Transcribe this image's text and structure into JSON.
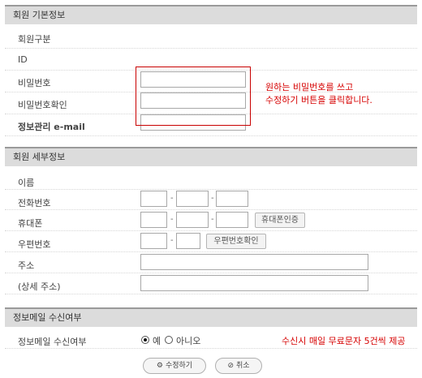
{
  "basic": {
    "header": "회원 기본정보",
    "member_type_label": "회원구분",
    "id_label": "ID",
    "password_label": "비밀번호",
    "password_confirm_label": "비밀번호확인",
    "email_label": "정보관리 e-mail",
    "notice_line1": "원하는 비밀번호를 쓰고",
    "notice_line2": "수정하기 버튼을 클릭합니다."
  },
  "detail": {
    "header": "회원 세부정보",
    "name_label": "이름",
    "phone_label": "전화번호",
    "mobile_label": "휴대폰",
    "mobile_verify_button": "휴대폰인증",
    "zipcode_label": "우편번호",
    "zipcode_button": "우편번호확인",
    "address_label": "주소",
    "address_detail_label": "(상세 주소)",
    "dash": "-"
  },
  "mail": {
    "header": "정보메일 수신여부",
    "label": "정보메일 수신여부",
    "option_yes": "예",
    "option_no": "아니오",
    "selected": "예",
    "sms_notice": "수신시 매일 무료문자 5건씩 제공"
  },
  "actions": {
    "submit_label": "수정하기",
    "cancel_label": "취소"
  }
}
